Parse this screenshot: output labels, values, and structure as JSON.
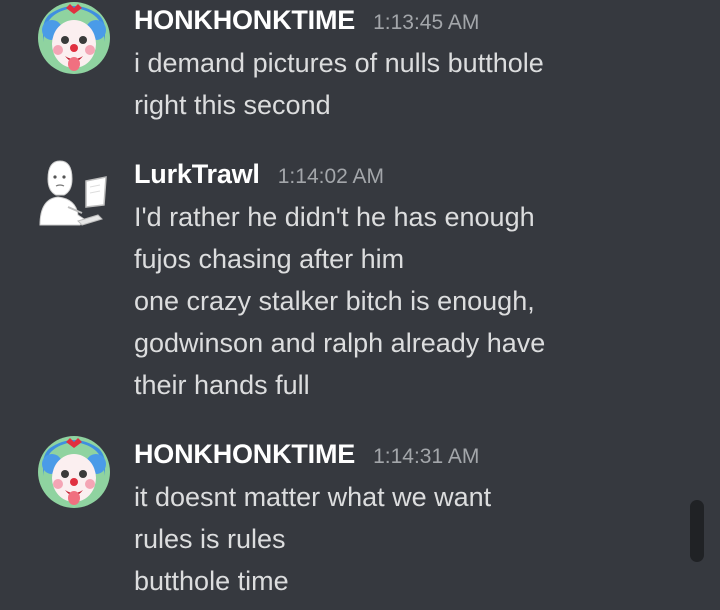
{
  "messages": [
    {
      "username": "HONKHONKTIME",
      "timestamp": "1:13:45 AM",
      "avatar": "clown-avatar",
      "lines": [
        "i demand pictures of nulls butthole",
        "right this second"
      ]
    },
    {
      "username": "LurkTrawl",
      "timestamp": "1:14:02 AM",
      "avatar": "wojak-computer-avatar",
      "lines": [
        "I'd rather he didn't he has enough",
        "fujos chasing after him",
        "one crazy stalker bitch is enough,",
        "godwinson and ralph already have",
        "their hands full"
      ]
    },
    {
      "username": "HONKHONKTIME",
      "timestamp": "1:14:31 AM",
      "avatar": "clown-avatar",
      "lines": [
        "it doesnt matter what we want",
        "rules is rules",
        "butthole time"
      ]
    }
  ],
  "colors": {
    "background": "#36393f",
    "username": "#ffffff",
    "timestamp": "#a3a6aa",
    "message_text": "#dcddde",
    "scrollbar": "#202225"
  }
}
